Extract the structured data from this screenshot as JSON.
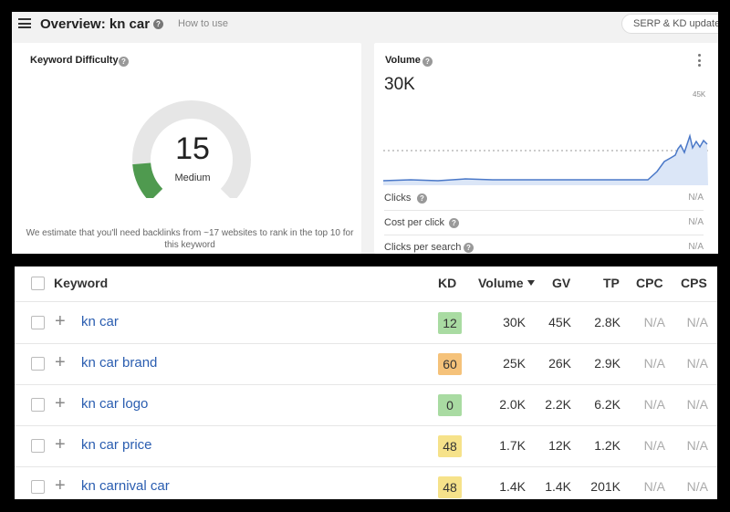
{
  "header": {
    "title": "Overview: kn car",
    "how_to": "How to use",
    "serp_button": "SERP & KD update"
  },
  "keyword_difficulty": {
    "title": "Keyword Difficulty",
    "value": "15",
    "level": "Medium",
    "score": 15,
    "note": "We estimate that you'll need backlinks from ~17 websites to rank in the top 10 for this keyword"
  },
  "volume": {
    "title": "Volume",
    "value": "30K",
    "axis_max": "45K",
    "metrics": [
      {
        "label": "Clicks",
        "value": "N/A"
      },
      {
        "label": "Cost per click",
        "value": "N/A"
      },
      {
        "label": "Clicks per search",
        "value": "N/A"
      }
    ]
  },
  "table": {
    "columns": {
      "keyword": "Keyword",
      "kd": "KD",
      "volume": "Volume",
      "gv": "GV",
      "tp": "TP",
      "cpc": "CPC",
      "cps": "CPS"
    },
    "rows": [
      {
        "keyword": "kn car",
        "kd": "12",
        "kd_color": "#a9dba2",
        "volume": "30K",
        "gv": "45K",
        "tp": "2.8K",
        "cpc": "N/A",
        "cps": "N/A"
      },
      {
        "keyword": "kn car brand",
        "kd": "60",
        "kd_color": "#f5c27a",
        "volume": "25K",
        "gv": "26K",
        "tp": "2.9K",
        "cpc": "N/A",
        "cps": "N/A"
      },
      {
        "keyword": "kn car logo",
        "kd": "0",
        "kd_color": "#a9dba2",
        "volume": "2.0K",
        "gv": "2.2K",
        "tp": "6.2K",
        "cpc": "N/A",
        "cps": "N/A"
      },
      {
        "keyword": "kn car price",
        "kd": "48",
        "kd_color": "#f6e28a",
        "volume": "1.7K",
        "gv": "12K",
        "tp": "1.2K",
        "cpc": "N/A",
        "cps": "N/A"
      },
      {
        "keyword": "kn carnival car",
        "kd": "48",
        "kd_color": "#f6e28a",
        "volume": "1.4K",
        "gv": "1.4K",
        "tp": "201K",
        "cpc": "N/A",
        "cps": "N/A"
      }
    ]
  },
  "colors": {
    "link": "#2a5db0",
    "gauge_fill": "#4f9a4f",
    "gauge_track": "#e6e6e6",
    "sparkline": "#4a78c8"
  },
  "icons": [
    "menu-icon",
    "help-icon",
    "kebab-menu-icon",
    "plus-icon",
    "sort-caret-icon",
    "checkbox-icon"
  ]
}
